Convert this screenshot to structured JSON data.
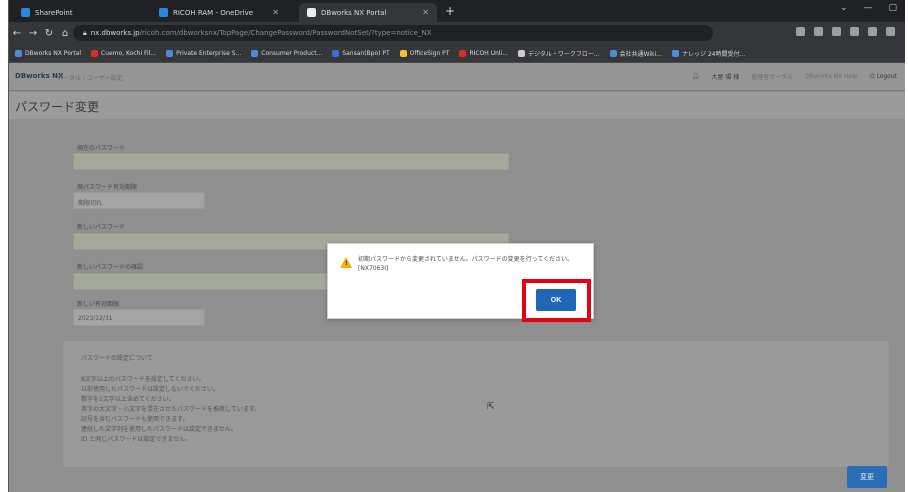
{
  "browser": {
    "tabs": [
      {
        "label": "SharePoint",
        "color": "#2b88d8"
      },
      {
        "label": "RICOH RAM - OneDrive",
        "color": "#2b88d8"
      },
      {
        "label": "DBworks NX Portal",
        "color": "#e8eaed"
      }
    ],
    "new_tab": "+",
    "url_host": "nx.dbworks.jp",
    "url_rest": "/ricoh.com/dbworksnx/TopPage/ChangePassword/PasswordNotSet/?type=notice_NX",
    "bookmarks": [
      {
        "label": "DBworks NX Portal",
        "color": "#4f8ad8"
      },
      {
        "label": "Cuemo, Kochi Fil...",
        "color": "#d93025"
      },
      {
        "label": "Private Enterprise S...",
        "color": "#4f8ad8"
      },
      {
        "label": "Consumer Product...",
        "color": "#4f8ad8"
      },
      {
        "label": "Sansan(Bpo) PT",
        "color": "#3a6fd8"
      },
      {
        "label": "OfficeSign PT",
        "color": "#f1c232"
      },
      {
        "label": "RICOH Unli...",
        "color": "#d93025"
      },
      {
        "label": "デジタル・ワークフロー...",
        "color": "#cccccc"
      },
      {
        "label": "会社共通Wiki...",
        "color": "#4f8ad8"
      },
      {
        "label": "ナレッジ 24時間受付...",
        "color": "#4f8ad8"
      }
    ]
  },
  "app": {
    "brand": "DBworks NX",
    "brand_sub": "ポータル / ユーザー設定",
    "user": "大屋 陽 様",
    "user_links": [
      "管理者ポータル",
      "DBworks NX Help"
    ],
    "logout": "Logout",
    "page_title": "パスワード変更"
  },
  "form": {
    "current_password_label": "現在のパスワード",
    "current_expiry_label": "現パスワード有効期限",
    "current_expiry_value": "期限切れ",
    "new_password_label": "新しいパスワード",
    "new_password_confirm_label": "新しいパスワードの確認",
    "new_expiry_label": "新しい有効期限",
    "new_expiry_value": "2023/12/31"
  },
  "notice": {
    "title": "パスワードの設定について",
    "lines": [
      "8文字以上のパスワードを設定してください。",
      "以前使用したパスワードは設定しないでください。",
      "数字を1文字以上含めてください。",
      "英字の大文字・小文字を混在させたパスワードを推奨しています。",
      "記号を含むパスワードも使用できます。",
      "連続した文字列を使用したパスワードは設定できません。",
      "ID と同じパスワードは設定できません。"
    ]
  },
  "save_label": "変更",
  "dialog": {
    "message": "初期パスワードから変更されていません。パスワードの変更を行ってください。[NX7063I]",
    "ok_label": "OK"
  },
  "colors": {
    "highlight": "#e60012",
    "button": "#1f66b8",
    "warning": "#f0b400"
  }
}
